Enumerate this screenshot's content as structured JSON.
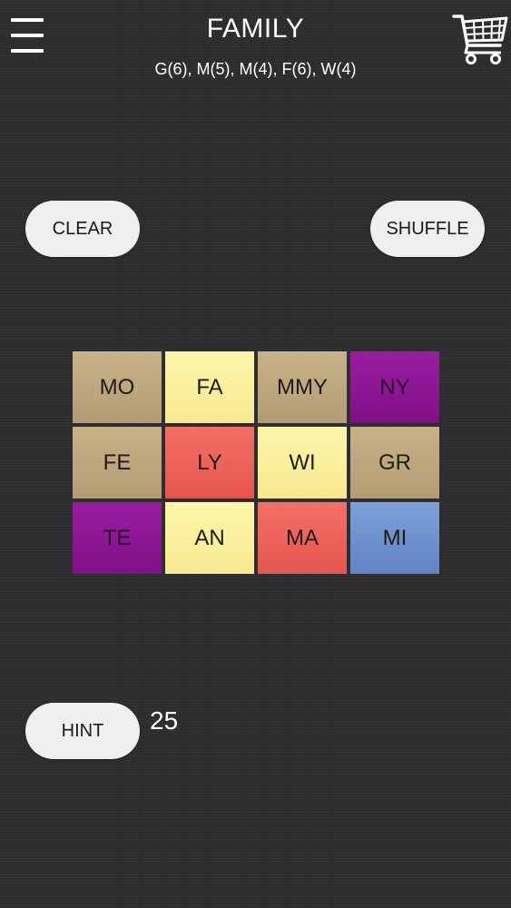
{
  "header": {
    "title": "FAMILY",
    "subtitle": "G(6), M(5), M(4), F(6), W(4)"
  },
  "buttons": {
    "clear": "CLEAR",
    "shuffle": "SHUFFLE",
    "hint": "HINT"
  },
  "hint_count": "25",
  "icons": {
    "menu": "menu-icon",
    "cart": "shopping-cart-icon"
  },
  "colors": {
    "background": "#2e2e30",
    "tan": "#c8b288",
    "yellow": "#fdf5a9",
    "purple": "#9a1da0",
    "red": "#f36f66",
    "blue": "#7da0d8"
  },
  "tiles": [
    [
      {
        "text": "MO",
        "color": "tan"
      },
      {
        "text": "FA",
        "color": "yellow"
      },
      {
        "text": "MMY",
        "color": "tan"
      },
      {
        "text": "NY",
        "color": "purple"
      }
    ],
    [
      {
        "text": "FE",
        "color": "tan"
      },
      {
        "text": "LY",
        "color": "red"
      },
      {
        "text": "WI",
        "color": "yellow"
      },
      {
        "text": "GR",
        "color": "tan"
      }
    ],
    [
      {
        "text": "TE",
        "color": "purple"
      },
      {
        "text": "AN",
        "color": "yellow"
      },
      {
        "text": "MA",
        "color": "red"
      },
      {
        "text": "MI",
        "color": "blue"
      }
    ]
  ]
}
